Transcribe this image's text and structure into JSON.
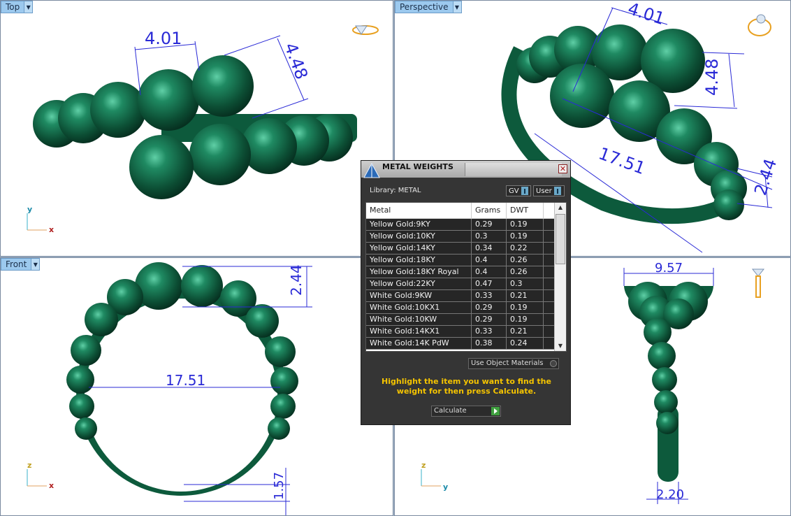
{
  "viewports": {
    "top": {
      "label": "Top"
    },
    "perspective": {
      "label": "Perspective"
    },
    "front": {
      "label": "Front"
    }
  },
  "dimensions": {
    "top_width": "4.01",
    "top_height": "4.48",
    "persp_width": "4.01",
    "persp_height": "4.48",
    "persp_side": "2.44",
    "persp_diameter": "17.51",
    "front_height": "2.44",
    "front_diameter": "17.51",
    "front_band": "1.57",
    "right_width": "9.57",
    "right_base": "2.20"
  },
  "axes": {
    "x": "x",
    "y": "y",
    "z": "z"
  },
  "dialog": {
    "title": "METAL WEIGHTS",
    "library_label": "Library: METAL",
    "switch_gv": "GV",
    "switch_user": "User",
    "columns": [
      "Metal",
      "Grams",
      "DWT"
    ],
    "rows": [
      [
        "Yellow Gold:9KY",
        "0.29",
        "0.19"
      ],
      [
        "Yellow Gold:10KY",
        "0.3",
        "0.19"
      ],
      [
        "Yellow Gold:14KY",
        "0.34",
        "0.22"
      ],
      [
        "Yellow Gold:18KY",
        "0.4",
        "0.26"
      ],
      [
        "Yellow Gold:18KY Royal",
        "0.4",
        "0.26"
      ],
      [
        "Yellow Gold:22KY",
        "0.47",
        "0.3"
      ],
      [
        "White Gold:9KW",
        "0.33",
        "0.21"
      ],
      [
        "White Gold:10KX1",
        "0.29",
        "0.19"
      ],
      [
        "White Gold:10KW",
        "0.29",
        "0.19"
      ],
      [
        "White Gold:14KX1",
        "0.33",
        "0.21"
      ],
      [
        "White Gold:14K PdW",
        "0.38",
        "0.24"
      ]
    ],
    "use_object_materials": "Use Object Materials",
    "message": "Highlight the item you want to find the weight for then press Calculate.",
    "calculate_label": "Calculate",
    "accent_color": "#f5c400"
  },
  "colors": {
    "gem": "#0f5a3d",
    "dimension": "#2a2ad6",
    "tab": "#9cc9ee"
  }
}
